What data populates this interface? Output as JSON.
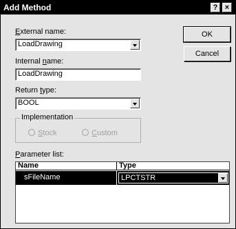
{
  "window": {
    "title": "Add Method",
    "help_glyph": "?",
    "close_glyph": "×"
  },
  "external_name": {
    "label_pre": "",
    "label_key": "E",
    "label_post": "xternal name:",
    "value": "LoadDrawing"
  },
  "internal_name": {
    "label_pre": "Internal ",
    "label_key": "n",
    "label_post": "ame:",
    "value": "LoadDrawing"
  },
  "return_type": {
    "label_pre": "Return ",
    "label_key": "t",
    "label_post": "ype:",
    "value": "BOOL"
  },
  "implementation": {
    "label": "Implementation",
    "stock_key": "S",
    "stock_rest": "tock",
    "custom_key": "C",
    "custom_rest": "ustom"
  },
  "parameter_list": {
    "label_pre": "",
    "label_key": "P",
    "label_post": "arameter list:",
    "columns": [
      "Name",
      "Type"
    ],
    "rows": [
      {
        "name": "sFileName",
        "type": "LPCTSTR"
      }
    ]
  },
  "buttons": {
    "ok": "OK",
    "cancel": "Cancel"
  }
}
